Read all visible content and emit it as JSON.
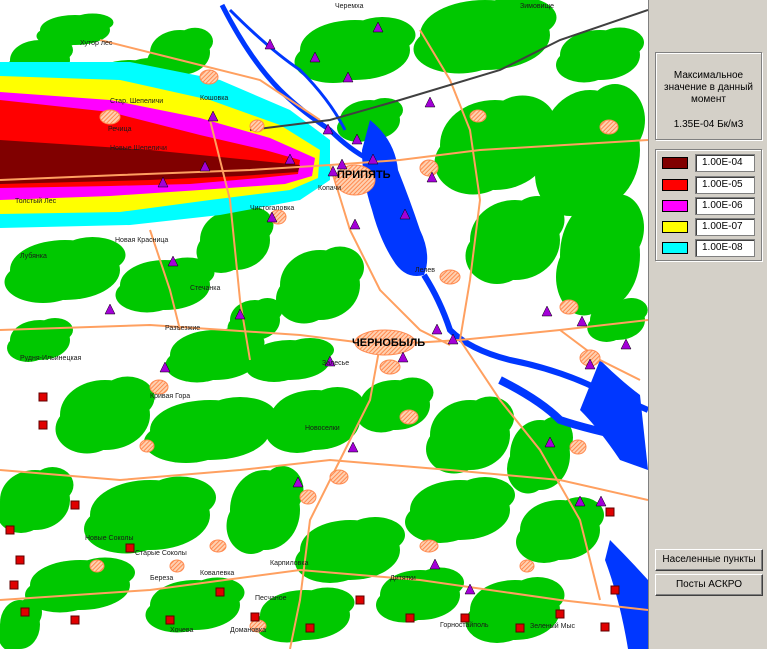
{
  "info": {
    "caption": "Максимальное значение в данный момент",
    "value": "1.35E-04 Бк/м3"
  },
  "legend": [
    {
      "label": "1.00E-04",
      "color": "#800000"
    },
    {
      "label": "1.00E-05",
      "color": "#ff0000"
    },
    {
      "label": "1.00E-06",
      "color": "#ff00ff"
    },
    {
      "label": "1.00E-07",
      "color": "#ffff00"
    },
    {
      "label": "1.00E-08",
      "color": "#00ffff"
    }
  ],
  "buttons": {
    "settlements": "Населенные пункты",
    "askro": "Посты АСКРО"
  },
  "map": {
    "city_pripyat": "ПРИПЯТЬ",
    "city_chernobyl": "ЧЕРНОБЫЛЬ",
    "places": [
      "Черемха",
      "Зимовище",
      "Хутор лес",
      "Стар. Шепеличи",
      "Речица",
      "Новые Шепеличи",
      "Лелев",
      "Копачи",
      "Чистогаловка",
      "Залесье",
      "Рудня-Ильинецкая",
      "Разъезжие",
      "Карпиловка",
      "Новые Соколы",
      "Старые Соколы",
      "Береза",
      "Ковалевка",
      "Песчаное",
      "Новая Красница",
      "Кошовка",
      "Толстый Лес",
      "Лубянка",
      "Стечанка",
      "Домановка",
      "Хочева",
      "Горностайполь",
      "Дитятки",
      "Зеленый Мыс",
      "Кривая Гора",
      "Новоселки"
    ],
    "mark_colors": {
      "forest": "#00c800",
      "water": "#0037ff",
      "road": "#ffa060",
      "settlement": "#ff8a50",
      "post": "#a300d8",
      "post_outline": "#000000"
    }
  }
}
